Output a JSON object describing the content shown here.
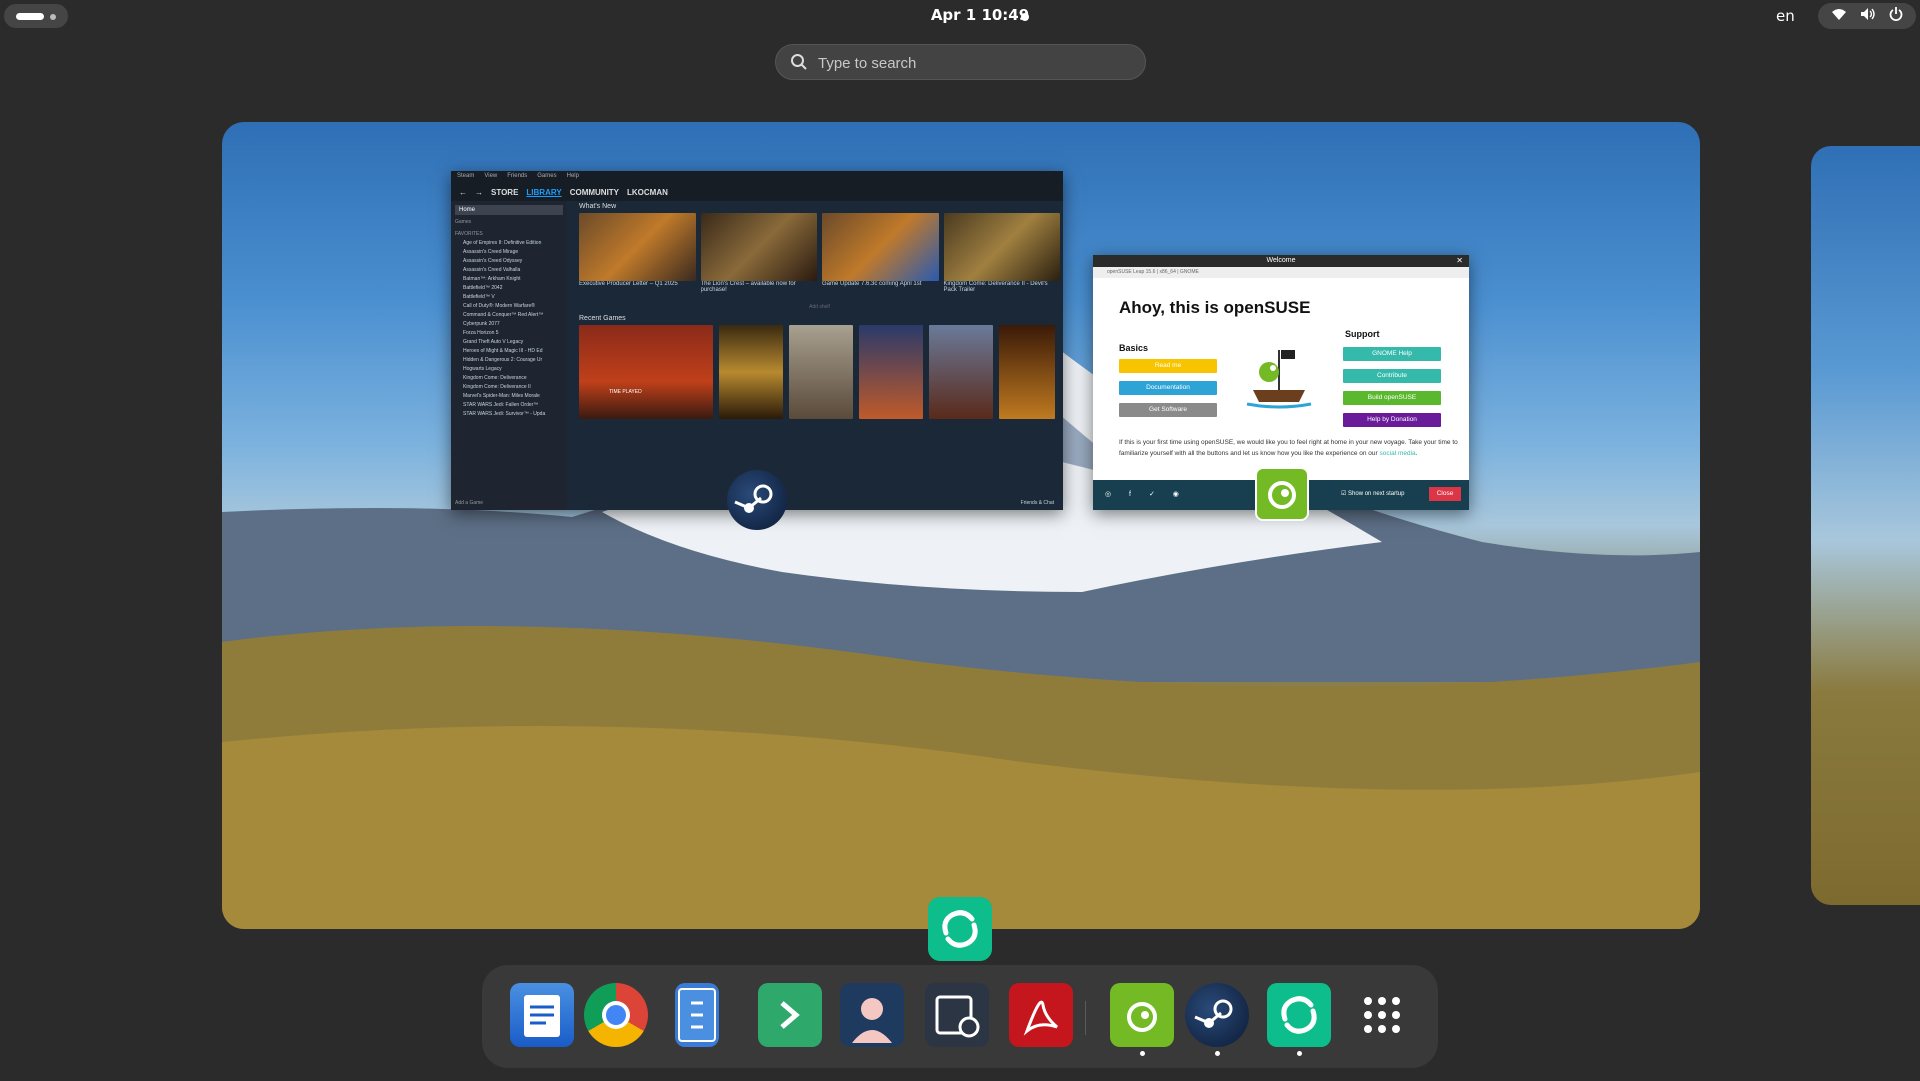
{
  "topbar": {
    "clock": "Apr 1  10:49",
    "language": "en",
    "icons": [
      "wifi-icon",
      "volume-icon",
      "power-icon"
    ]
  },
  "search": {
    "placeholder": "Type to search"
  },
  "steam_window": {
    "menu": [
      "Steam",
      "View",
      "Friends",
      "Games",
      "Help"
    ],
    "nav": [
      "STORE",
      "LIBRARY",
      "COMMUNITY",
      "LKOCMAN"
    ],
    "active_nav": "LIBRARY",
    "sidebar": {
      "home": "Home",
      "filter": "Games",
      "favorites_label": "FAVORITES",
      "games": [
        "Age of Empires II: Definitive Edition",
        "Assassin's Creed Mirage",
        "Assassin's Creed Odyssey",
        "Assassin's Creed Valhalla",
        "Batman™: Arkham Knight",
        "Battlefield™ 2042",
        "Battlefield™ V",
        "Call of Duty®: Modern Warfare®",
        "Command & Conquer™ Red Alert™",
        "Cyberpunk 2077",
        "Forza Horizon 5",
        "Grand Theft Auto V Legacy",
        "Heroes of Might & Magic III - HD Ed",
        "Hidden & Dangerous 2: Courage Ur",
        "Hogwarts Legacy",
        "Kingdom Come: Deliverance",
        "Kingdom Come: Deliverance II",
        "Marvel's Spider-Man: Miles Morale",
        "STAR WARS Jedi: Fallen Order™",
        "STAR WARS Jedi: Survivor™ - Upda"
      ],
      "add_game": "Add a Game"
    },
    "whats_new_label": "What's New",
    "news": [
      "Executive Producer Letter – Q1 2025",
      "The Lion's Crest – available now for purchase!",
      "Game Update 7.6.3c coming April 1st",
      "Kingdom Come: Deliverance II - Devil's Pack Trailer"
    ],
    "add_shelf": "Add shelf",
    "recent_label": "Recent Games",
    "time_played": "TIME PLAYED",
    "friends_chat": "Friends & Chat"
  },
  "welcome_window": {
    "title": "Welcome",
    "info": "openSUSE Leap 15.6  |  x86_64  |  GNOME",
    "heading": "Ahoy, this is openSUSE",
    "basics_label": "Basics",
    "support_label": "Support",
    "basics_buttons": [
      "Read me",
      "Documentation",
      "Get Software"
    ],
    "support_buttons": [
      "GNOME Help",
      "Contribute",
      "Build openSUSE",
      "Help by Donation"
    ],
    "paragraph": "If this is your first time using openSUSE, we would like you to feel right at home in your new voyage. Take your time to familiarize yourself with all the buttons and let us know how you like the experience on our",
    "link": "social media",
    "show_on_startup": "Show on next startup",
    "close": "Close",
    "colors": {
      "yellow": "#f8c400",
      "blue": "#2ea3d6",
      "gray": "#8a8a8a",
      "teal": "#35b9ab",
      "green": "#5ab82e",
      "purple": "#6a1b9a",
      "red": "#dc3545"
    }
  },
  "dash": {
    "apps": [
      "text-editor-icon",
      "chrome-icon",
      "files-icon",
      "terminal-icon",
      "contacts-icon",
      "video-trimmer-icon",
      "acrobat-icon",
      "opensuse-welcome-icon",
      "steam-icon",
      "element-icon",
      "app-grid-icon"
    ]
  }
}
